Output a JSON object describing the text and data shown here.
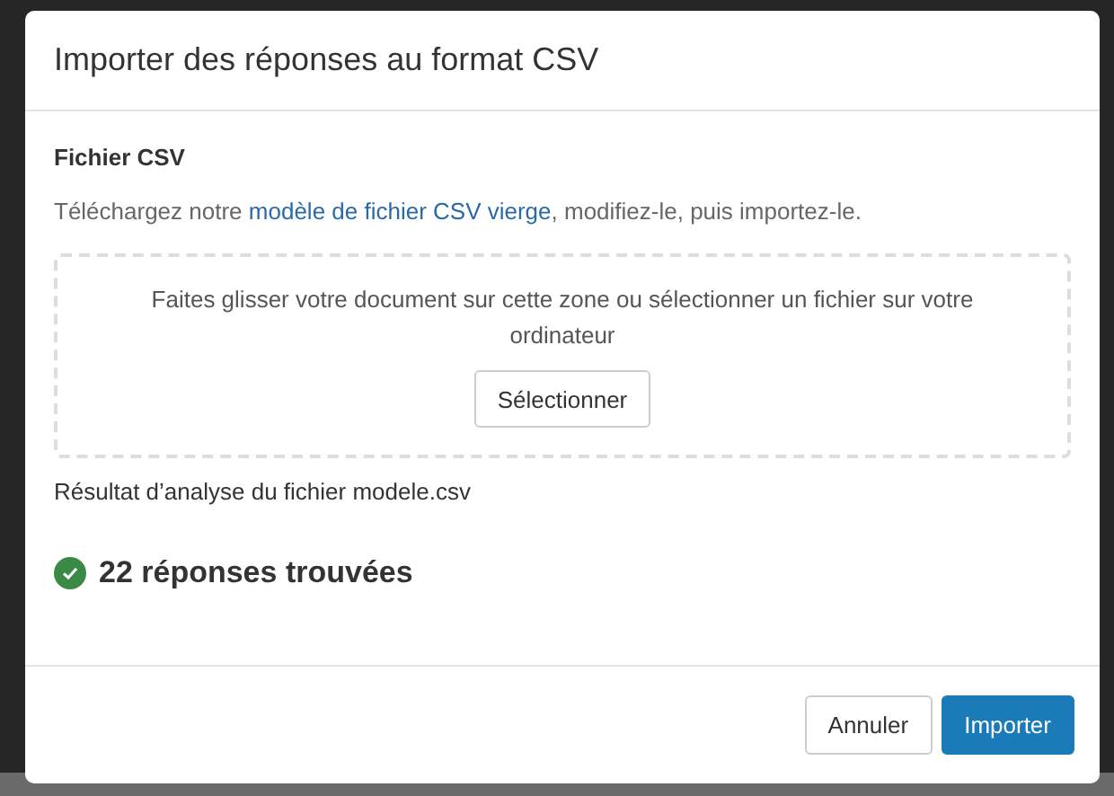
{
  "dialog": {
    "title": "Importer des réponses au format CSV",
    "section_title": "Fichier CSV",
    "instructions": {
      "before": "Téléchargez notre",
      "link": "modèle de fichier CSV vierge",
      "after": ", modifiez-le, puis importez-le."
    },
    "dropzone": {
      "text": "Faites glisser votre document sur cette zone ou sélectionner un fichier sur votre ordinateur",
      "button": "Sélectionner"
    },
    "analysis_label": "Résultat d’analyse du fichier modele.csv",
    "result": {
      "success": true,
      "text": "22 réponses trouvées"
    },
    "buttons": [
      {
        "label": "Annuler",
        "kind": "secondary"
      },
      {
        "label": "Importer",
        "kind": "primary"
      }
    ]
  }
}
